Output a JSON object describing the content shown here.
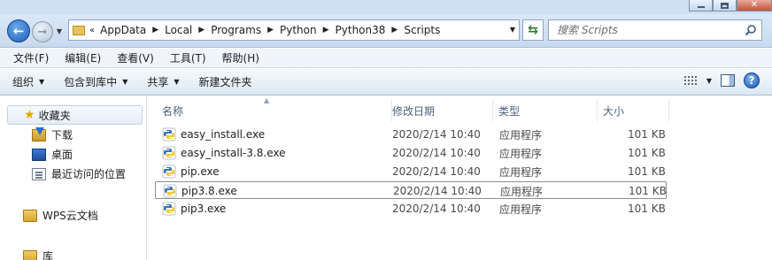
{
  "address": {
    "breadcrumb": [
      "AppData",
      "Local",
      "Programs",
      "Python",
      "Python38",
      "Scripts"
    ],
    "overflow_chevron": "«",
    "search_placeholder": "搜索 Scripts"
  },
  "menubar": {
    "items": [
      "文件(F)",
      "编辑(E)",
      "查看(V)",
      "工具(T)",
      "帮助(H)"
    ]
  },
  "commandbar": {
    "organize": "组织",
    "include_in_library": "包含到库中",
    "share": "共享",
    "new_folder": "新建文件夹"
  },
  "navpane": {
    "favorites_label": "收藏夹",
    "items": [
      "下载",
      "桌面",
      "最近访问的位置"
    ],
    "wps_label": "WPS云文档",
    "library_label": "库"
  },
  "filelist": {
    "columns": [
      "名称",
      "修改日期",
      "类型",
      "大小"
    ],
    "rows": [
      {
        "name": "easy_install.exe",
        "date": "2020/2/14 10:40",
        "type": "应用程序",
        "size": "101 KB"
      },
      {
        "name": "easy_install-3.8.exe",
        "date": "2020/2/14 10:40",
        "type": "应用程序",
        "size": "101 KB"
      },
      {
        "name": "pip.exe",
        "date": "2020/2/14 10:40",
        "type": "应用程序",
        "size": "101 KB"
      },
      {
        "name": "pip3.8.exe",
        "date": "2020/2/14 10:40",
        "type": "应用程序",
        "size": "101 KB"
      },
      {
        "name": "pip3.exe",
        "date": "2020/2/14 10:40",
        "type": "应用程序",
        "size": "101 KB"
      }
    ],
    "selected_index": 3
  },
  "icons": {
    "file": "python-file-icon",
    "favorites": "star-icon",
    "download": "download-folder-icon",
    "desktop": "desktop-icon",
    "recent": "recent-places-icon"
  }
}
